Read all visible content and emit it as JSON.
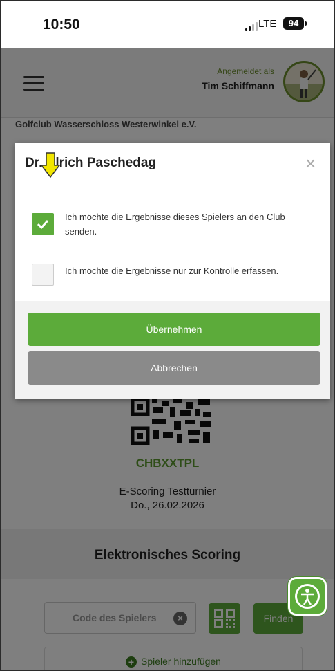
{
  "status_bar": {
    "time": "10:50",
    "network": "LTE",
    "battery": "94"
  },
  "header": {
    "logged_in_label": "Angemeldet als",
    "user_name": "Tim Schiffmann"
  },
  "club_name": "Golfclub Wasserschloss Westerwinkel e.V.",
  "modal": {
    "title": "Dr. Ulrich Paschedag",
    "close_symbol": "×",
    "option_send": {
      "label": "Ich möchte die Ergebnisse dieses Spielers an den Club senden.",
      "checked": true
    },
    "option_control": {
      "label": "Ich möchte die Ergebnisse nur zur Kontrolle erfassen.",
      "checked": false
    },
    "confirm_label": "Übernehmen",
    "cancel_label": "Abbrechen"
  },
  "tournament": {
    "code": "CHBXXTPL",
    "name": "E-Scoring Testturnier",
    "date": "Do., 26.02.2026"
  },
  "scoring": {
    "title": "Elektronisches Scoring",
    "player_code_placeholder": "Code des Spielers",
    "find_label": "Finden",
    "add_player_label": "Spieler hinzufügen"
  },
  "colors": {
    "accent": "#5cab3a",
    "cancel": "#8a8a8a",
    "arrow": "#f2e600"
  },
  "icons": [
    "menu-icon",
    "avatar",
    "qr-scan-icon",
    "clear-icon",
    "plus-circle-icon",
    "accessibility-icon",
    "down-arrow-icon",
    "checkmark-icon",
    "close-icon"
  ]
}
